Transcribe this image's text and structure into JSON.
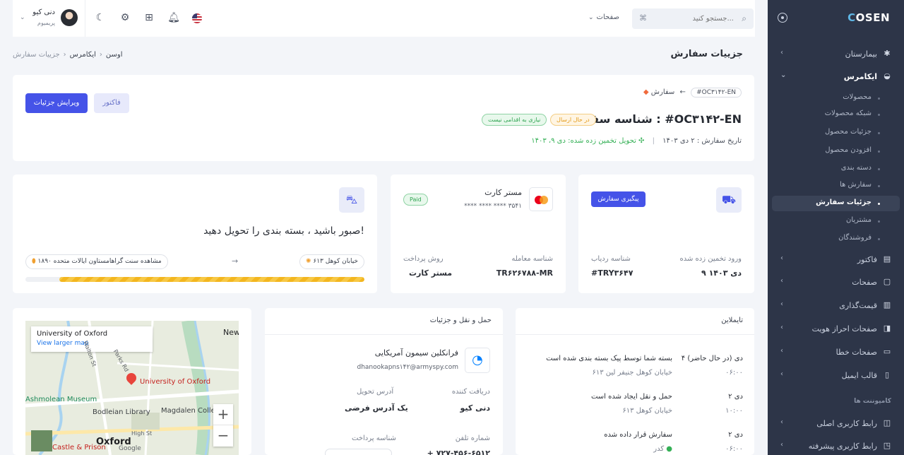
{
  "sidebar": {
    "brand": "OSEN",
    "brand_lead": "C",
    "items": [
      {
        "label": "بیمارستان",
        "icon": "hospital-icon"
      },
      {
        "label": "ایکامرس",
        "icon": "basket-icon"
      },
      {
        "label": "فاکتور",
        "icon": "invoice-icon"
      },
      {
        "label": "صفحات",
        "icon": "pages-icon"
      },
      {
        "label": "قیمت‌گذاری",
        "icon": "pricing-icon"
      },
      {
        "label": "صفحات احراز هویت",
        "icon": "auth-icon"
      },
      {
        "label": "صفحات خطا",
        "icon": "error-icon"
      },
      {
        "label": "قالب ایمیل",
        "icon": "email-icon"
      },
      {
        "label": "رابط کاربری اصلی",
        "icon": "ui-icon"
      },
      {
        "label": "رابط کاربری پیشرفته",
        "icon": "advanced-ui-icon"
      }
    ],
    "sub_items": [
      "محصولات",
      "شبکه محصولات",
      "جزئیات محصول",
      "افزودن محصول",
      "دسته بندی",
      "سفارش ها",
      "جزئیات سفارش",
      "مشتریان",
      "فروشندگان"
    ],
    "section": "کامپوننت ها"
  },
  "topbar": {
    "search_placeholder": "جستجو کنید...",
    "search_shortcut": "⌘",
    "pages_label": "صفحات",
    "user_name": "دنی کیو",
    "user_role": "پریمیوم"
  },
  "header": {
    "title": "جزییات سفارش",
    "breadcrumb": [
      "اوسن",
      "ایکامرس",
      "جزییات سفارش"
    ]
  },
  "order": {
    "crumb_label": "سفارش",
    "crumb_code": "#OC۳۱۴۲-EN",
    "title": "شناسه سفارش : #OC۳۱۴۲-EN",
    "badge_sending": "در حال ارسال",
    "badge_no_action": "نیازی به اقدامی نیست",
    "date_text": "تاریخ سفارش : ۲ دی ۱۴۰۳",
    "estimate_text": "تحویل تخمین زده شده: دی ۹، ۱۴۰۳",
    "invoice_btn": "فاکتور",
    "edit_btn": "ویرایش جزئیات"
  },
  "tracking": {
    "button": "پیگیری سفارش",
    "eta_label": "ورود تخمین زده شده",
    "eta_value": "۹ دی ۱۴۰۳",
    "track_label": "شناسه ردیاب",
    "track_value": "#TRY۳۶۴۷"
  },
  "payment": {
    "card_name": "مستر کارت",
    "card_number": "**** **** **** ۳۵۴۱",
    "status": "Paid",
    "txn_label": "شناسه معامله",
    "txn_value": "TR۶۲۶۷۸۸-MR",
    "method_label": "روش پرداخت",
    "method_value": "مستر کارت"
  },
  "delivery": {
    "message": "صبور باشید ، بسته بندی را تحویل دهید!",
    "from": "۶۱۳ خیابان کوهل",
    "to": "۱۸۹۰ مشاهده سنت گراهامستاون ایالات متحده",
    "arrow": "→",
    "progress_fraction": 0.9
  },
  "shipping": {
    "title": "حمل و نقل و جزئیات",
    "company": "فرانکلین سیمون آمریکایی",
    "email": "dhanookapns۱۴۲@armyspy.com",
    "receiver_label": "دریافت کننده",
    "receiver_value": "دنی کیو",
    "address_label": "آدرس تحویل",
    "address_value": "یک آدرس فرضی",
    "phone_label": "شماره تلفن",
    "phone_value": "+ ۷۲۷-۴۵۶-۶۵۱۲",
    "payment_id_label": "شناسه پرداخت"
  },
  "timeline": {
    "title": "تایملاین",
    "events": [
      {
        "date": "۴ دی (در حال حاضر)",
        "time": "۰۶:۰۰",
        "title": "بسته شما توسط پیک بسته بندی شده است",
        "sub": "۶۱۳ خیابان کوهل جنیفر لین"
      },
      {
        "date": "۲ دی",
        "time": "۱۰:۰۰",
        "title": "حمل و نقل ایجاد شده است",
        "sub": "۶۱۳ خیابان کوهل"
      },
      {
        "date": "۲ دی",
        "time": "۰۶:۰۰",
        "title": "سفارش قرار داده شده",
        "sub": "کدر"
      }
    ]
  },
  "map": {
    "place": "University of Oxford",
    "link": "View larger map",
    "labels": [
      "University of Oxford",
      "Ashmolean Museum",
      "Bodleian Library",
      "Magdalen College",
      "Oxford",
      "High St",
      "Castle & Prison",
      "New",
      "Walton St",
      "Parks Rd",
      "Google"
    ]
  }
}
